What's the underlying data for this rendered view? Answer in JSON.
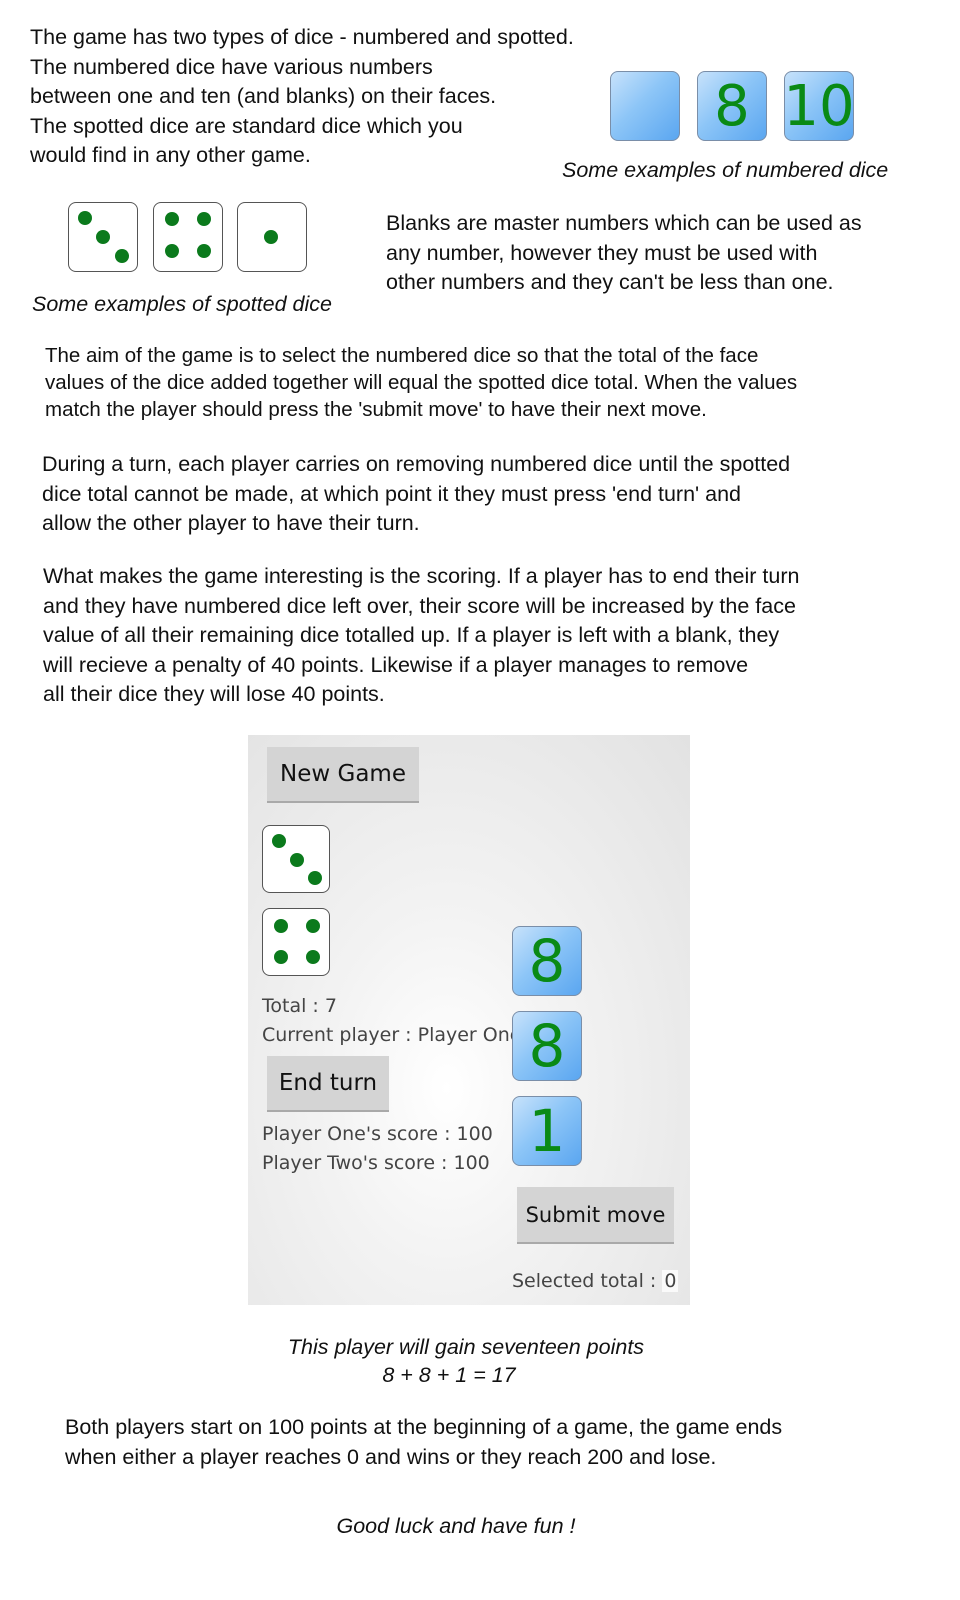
{
  "intro": {
    "paragraph": "The game has two types of dice - numbered and spotted.\nThe numbered dice have various numbers\nbetween one and ten (and blanks) on their faces.\nThe spotted dice are standard dice which you\nwould find in any other game.",
    "numbered_examples": [
      "",
      "8",
      "10"
    ],
    "numbered_caption": "Some examples of numbered dice",
    "spotted_examples": [
      3,
      4,
      1
    ],
    "spotted_caption": "Some examples of spotted dice",
    "blanks_paragraph": "Blanks are master numbers which can be used as\nany number, however they must be used with\nother numbers and they can't be less than one."
  },
  "rules": {
    "aim": "The aim of the game is to select the numbered dice so that the total of the face\nvalues of the dice added together will equal the spotted dice total. When the values\nmatch the player should press the 'submit move' to have their next move.",
    "turn": "During a turn, each player carries on removing numbered dice until the spotted\ndice total cannot be made, at which point it they must press 'end turn' and\nallow the other player to have their turn.",
    "scoring": "What makes the game interesting is the scoring. If a player has to end their turn\nand they have numbered dice left over, their score will be increased by the face\nvalue of all their remaining dice totalled up. If a player is left with a blank, they\nwill recieve a penalty of 40 points. Likewise if a player manages to remove\nall their dice they will lose 40 points."
  },
  "app": {
    "new_game_label": "New Game",
    "spotted_dice": [
      3,
      4
    ],
    "total_text": "Total : 7",
    "current_player_text": "Current player : Player One",
    "end_turn_label": "End turn",
    "player_one_score_text": "Player One's score : 100",
    "player_two_score_text": "Player Two's score : 100",
    "numbered_dice": [
      "8",
      "8",
      "1"
    ],
    "submit_label": "Submit move",
    "selected_total_label": "Selected total : ",
    "selected_total_value": "0"
  },
  "example": {
    "caption": "This player will gain seventeen points",
    "equation": "8 + 8 + 1 = 17"
  },
  "outro": {
    "start_paragraph": "Both players start on 100 points at the beginning of a game, the game ends\nwhen either a player reaches 0 and wins or they reach 200 and lose.",
    "closing": "Good luck and have fun !"
  },
  "colors": {
    "pip": "#0b7a1c",
    "numbered_die_digit": "#0a8a15",
    "numbered_die_fill": "#8cc5f7"
  }
}
